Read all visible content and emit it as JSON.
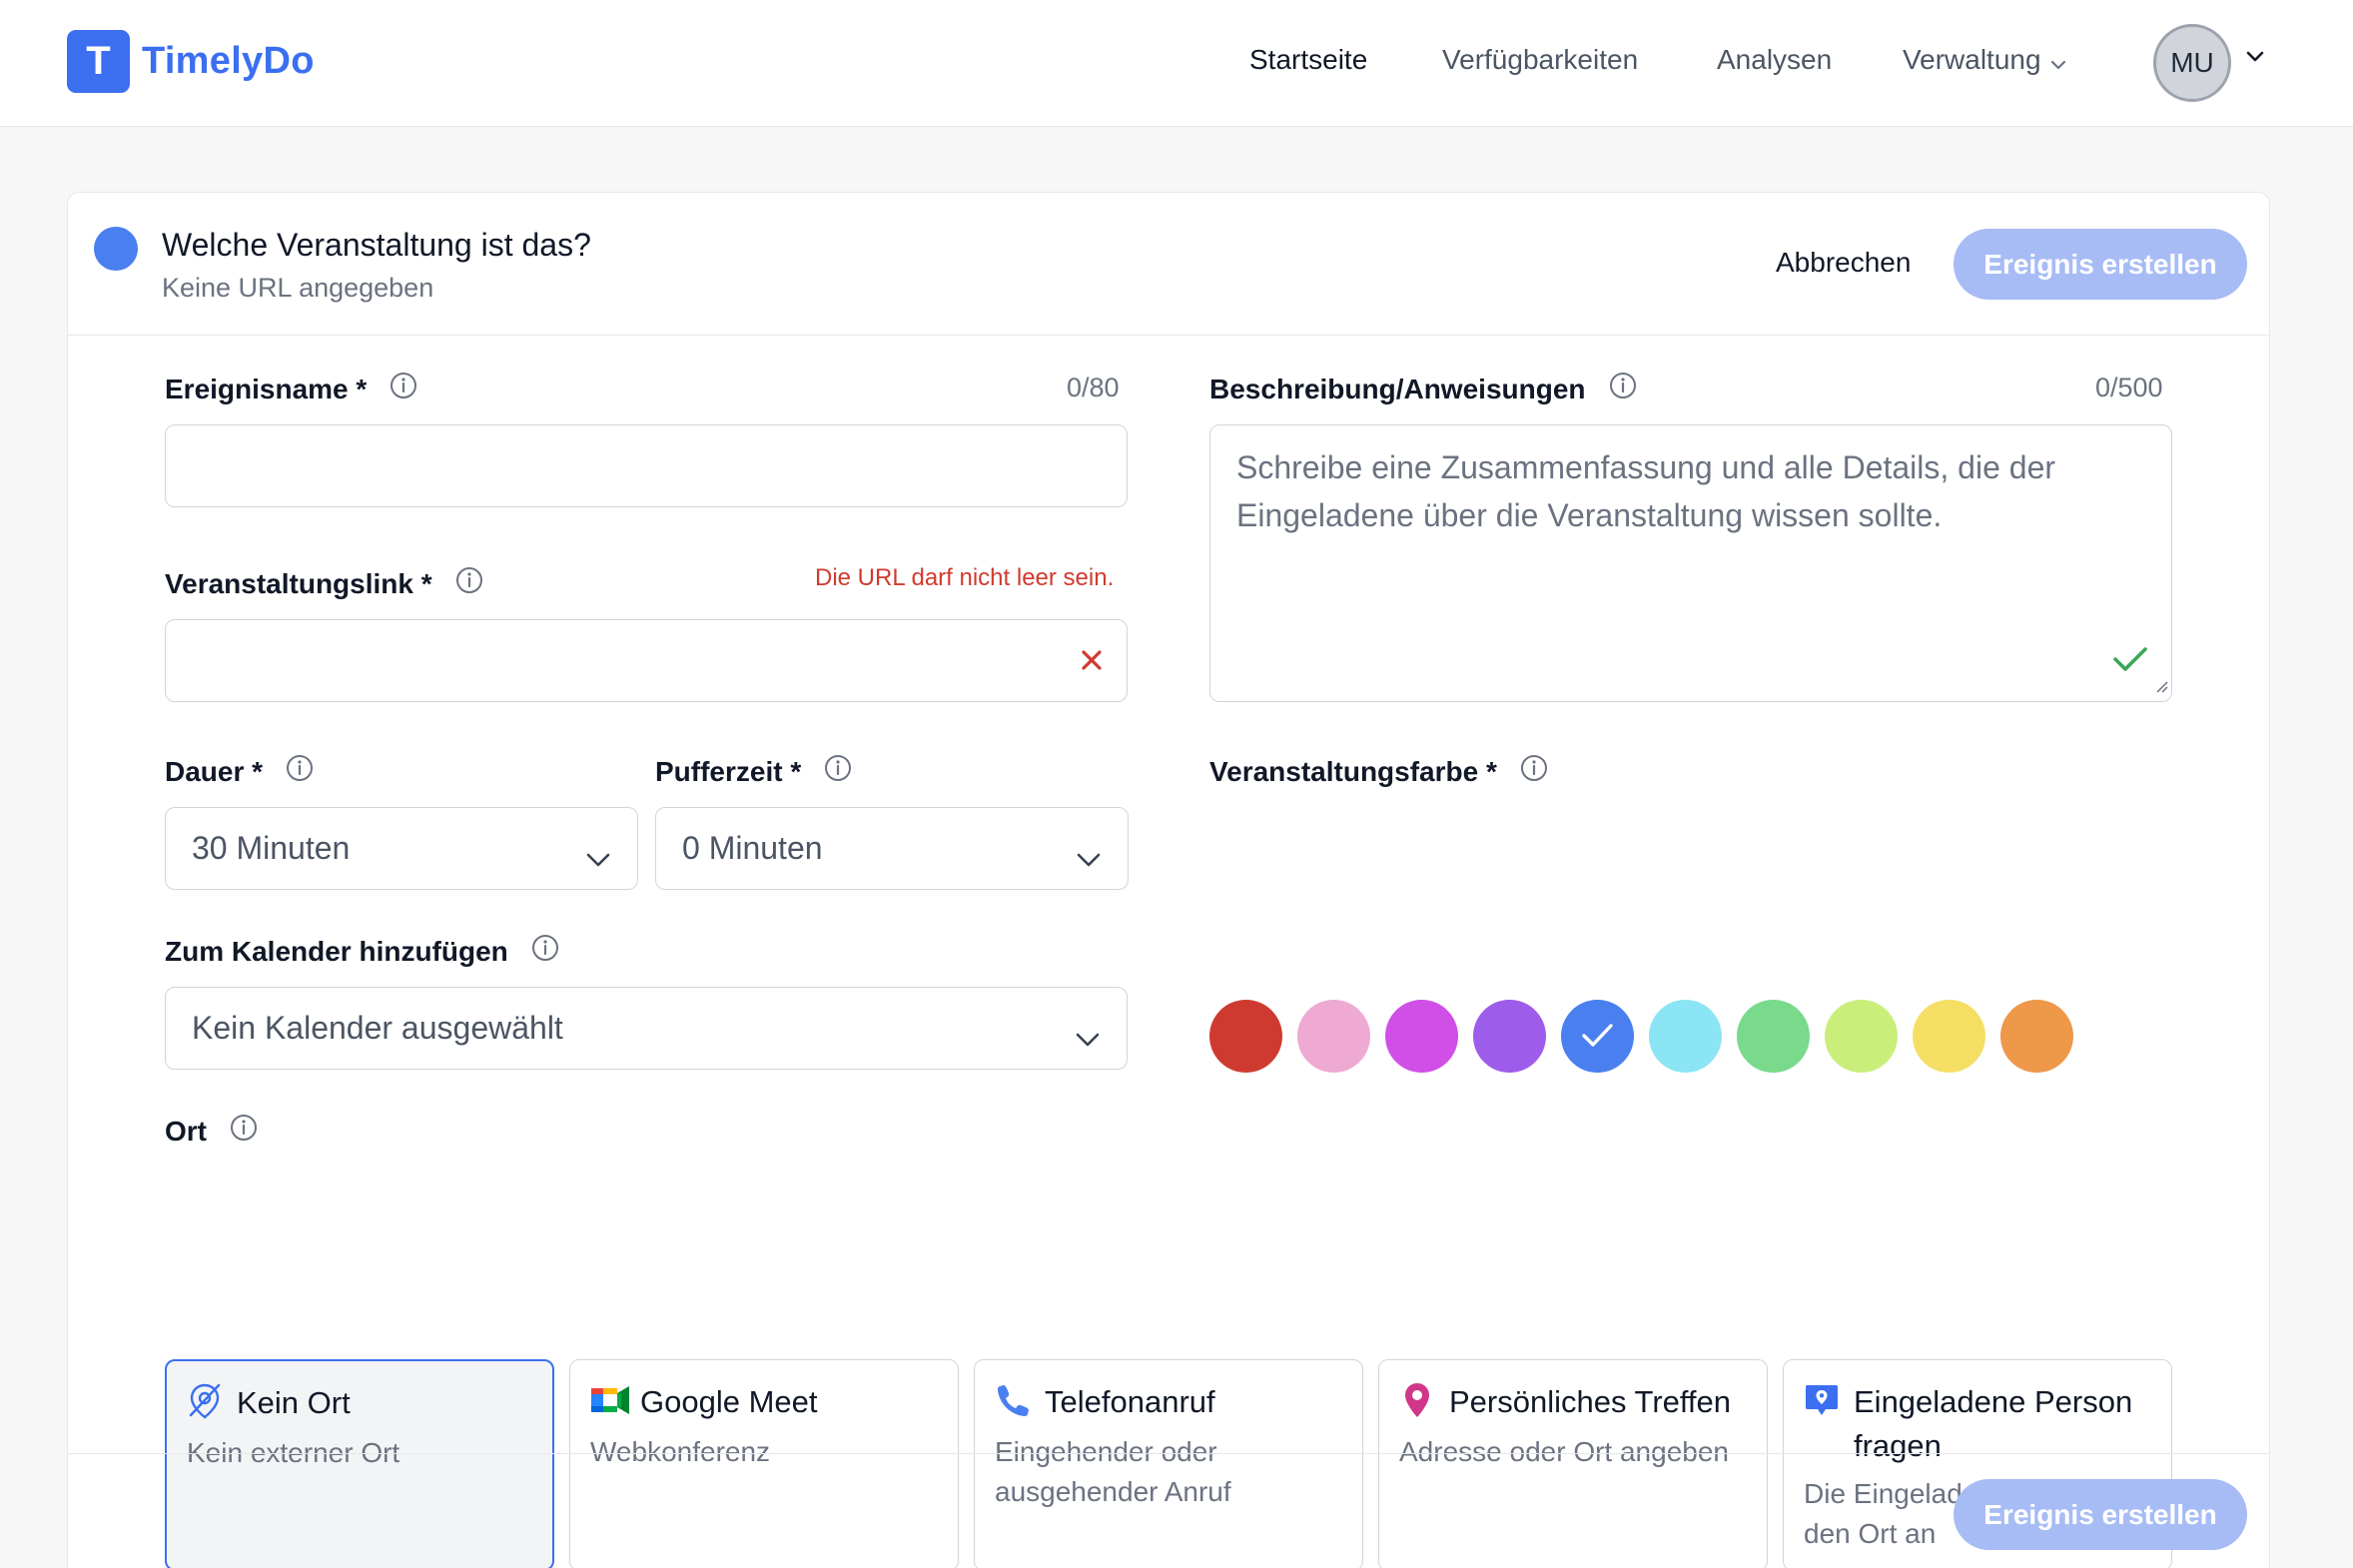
{
  "app": {
    "logo_letter": "T",
    "name": "TimelyDo"
  },
  "nav": {
    "home": "Startseite",
    "availability": "Verfügbarkeiten",
    "analytics": "Analysen",
    "admin": "Verwaltung",
    "avatar_initials": "MU"
  },
  "header": {
    "title": "Welche Veranstaltung ist das?",
    "subtitle": "Keine URL angegeben",
    "cancel": "Abbrechen",
    "create": "Ereignis erstellen",
    "event_color": "#4a7ff0"
  },
  "form": {
    "name_label": "Ereignisname *",
    "name_counter": "0/80",
    "name_value": "",
    "link_label": "Veranstaltungslink *",
    "link_error": "Die URL darf nicht leer sein.",
    "link_value": "",
    "duration_label": "Dauer *",
    "duration_value": "30 Minuten",
    "buffer_label": "Pufferzeit *",
    "buffer_value": "0 Minuten",
    "calendar_label": "Zum Kalender hinzufügen",
    "calendar_value": "Kein Kalender ausgewählt",
    "description_label": "Beschreibung/Anweisungen",
    "description_counter": "0/500",
    "description_placeholder": "Schreibe eine Zusammenfassung und alle Details, die der Eingeladene über die Veranstaltung wissen sollte.",
    "color_label": "Veranstaltungsfarbe *",
    "colors": [
      "#cf3a30",
      "#eeaad2",
      "#d04fe7",
      "#9e5cea",
      "#4a7ff0",
      "#8be5f4",
      "#78da8a",
      "#c9ef7a",
      "#f5de64",
      "#ee984a"
    ],
    "selected_color": "#4a7ff0",
    "location_label": "Ort"
  },
  "locations": [
    {
      "title": "Kein Ort",
      "desc": "Kein externer Ort",
      "icon": "no-location-icon",
      "selected": true
    },
    {
      "title": "Google Meet",
      "desc": "Webkonferenz",
      "icon": "google-meet-icon",
      "selected": false
    },
    {
      "title": "Telefonanruf",
      "desc": "Eingehender oder ausgehender Anruf",
      "icon": "phone-icon",
      "selected": false
    },
    {
      "title": "Persönliches Treffen",
      "desc": "Adresse oder Ort angeben",
      "icon": "map-pin-icon",
      "selected": false
    },
    {
      "title": "Eingeladene Person fragen",
      "desc": "Die Eingeladene Person gibt den Ort an",
      "icon": "location-bubble-icon",
      "selected": false
    }
  ],
  "footer": {
    "create": "Ereignis erstellen"
  }
}
